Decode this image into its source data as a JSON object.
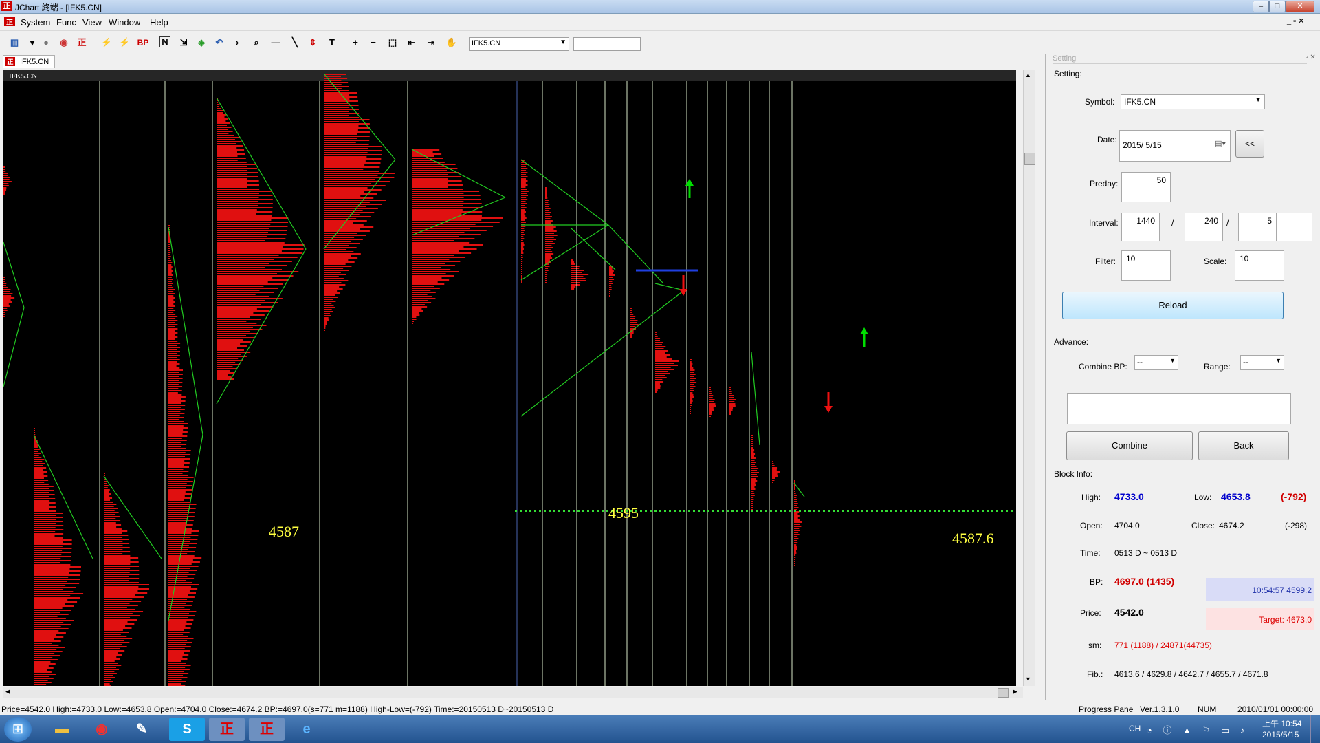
{
  "window": {
    "title": "JChart 終端 - [IFK5.CN]"
  },
  "menu": [
    "System",
    "Func",
    "View",
    "Window",
    "Help"
  ],
  "toolbar": {
    "bp_label": "BP",
    "symbol_value": "IFK5.CN"
  },
  "tab": {
    "label": "IFK5.CN"
  },
  "chart": {
    "corner_label": "IFK5.CN",
    "annotations": [
      "4587",
      "4595",
      "4587.6"
    ],
    "colors": {
      "background": "#000000",
      "profile": "#e01010",
      "trend": "#22cc22",
      "separator": "#d8e8c8",
      "level": "#ffff40",
      "dotted": "#33dd33",
      "up_arrow": "#00dd00",
      "down_arrow": "#ee1111"
    }
  },
  "panel": {
    "header": "Setting",
    "setting_label": "Setting:",
    "symbol_label": "Symbol:",
    "symbol_value": "IFK5.CN",
    "date_label": "Date:",
    "date_value": "2015/  5/15",
    "back_date_button": "<<",
    "preday_label": "Preday:",
    "preday_value": "50",
    "interval_label": "Interval:",
    "interval_1": "1440",
    "interval_sep1": "/",
    "interval_2": "240",
    "interval_sep2": "/",
    "interval_3": "5",
    "filter_label": "Filter:",
    "filter_value": "10",
    "scale_label": "Scale:",
    "scale_value": "10",
    "reload_button": "Reload",
    "advance_label": "Advance:",
    "combine_bp_label": "Combine BP:",
    "combine_bp_value": "--",
    "range_label": "Range:",
    "range_value": "--",
    "combine_button": "Combine",
    "back_button": "Back",
    "block_info_label": "Block Info:",
    "high_label": "High:",
    "high_value": "4733.0",
    "low_label": "Low:",
    "low_value": "4653.8",
    "diff_value": "(-792)",
    "open_label": "Open:",
    "open_value": "4704.0",
    "close_label": "Close:",
    "close_value": "4674.2",
    "close_diff": "(-298)",
    "time_label": "Time:",
    "time_value": "0513 D ~ 0513 D",
    "bp_label": "BP:",
    "bp_value": "4697.0 (1435)",
    "bp_time": "10:54:57  4599.2",
    "price_label": "Price:",
    "price_value": "4542.0",
    "target": "Target: 4673.0",
    "sm_label": "sm:",
    "sm_value": "771 (1188) / 24871(44735)",
    "fib_label": "Fib.:",
    "fib_value": "4613.6 / 4629.8 / 4642.7 / 4655.7 / 4671.8"
  },
  "status": {
    "main": "Price=4542.0  High:=4733.0  Low:=4653.8  Open:=4704.0  Close:=4674.2  BP:=4697.0(s=771 m=1188)  High-Low=(-792)  Time:=20150513 D~20150513 D",
    "progress": "Progress Pane",
    "version": "Ver.1.3.1.0",
    "num": "NUM",
    "datetime": "2010/01/01 00:00:00"
  },
  "taskbar": {
    "ime": "CH",
    "time": "上午 10:54",
    "date": "2015/5/15"
  }
}
